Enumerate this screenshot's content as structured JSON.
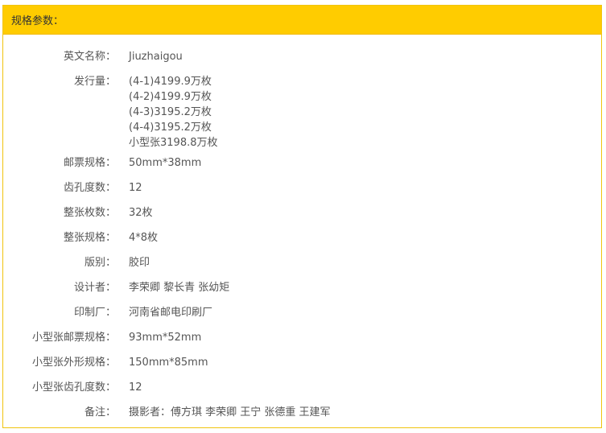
{
  "header": {
    "title": "规格参数："
  },
  "specs": [
    {
      "label": "英文名称：",
      "value": "Jiuzhaigou"
    },
    {
      "label": "发行量：",
      "lines": [
        "(4-1)4199.9万枚",
        "(4-2)4199.9万枚",
        "(4-3)3195.2万枚",
        "(4-4)3195.2万枚",
        "小型张3198.8万枚"
      ]
    },
    {
      "label": "邮票规格：",
      "value": "50mm*38mm"
    },
    {
      "label": "齿孔度数：",
      "value": "12"
    },
    {
      "label": "整张枚数：",
      "value": "32枚"
    },
    {
      "label": "整张规格：",
      "value": "4*8枚"
    },
    {
      "label": "版别：",
      "value": "胶印"
    },
    {
      "label": "设计者：",
      "value": "李荣卿 黎长青 张幼矩"
    },
    {
      "label": "印制厂：",
      "value": "河南省邮电印刷厂"
    },
    {
      "label": "小型张邮票规格：",
      "value": "93mm*52mm"
    },
    {
      "label": "小型张外形规格：",
      "value": "150mm*85mm"
    },
    {
      "label": "小型张齿孔度数：",
      "value": "12"
    },
    {
      "label": "备注：",
      "value": "摄影者：傅方琪 李荣卿 王宁 张德重 王建军"
    }
  ]
}
